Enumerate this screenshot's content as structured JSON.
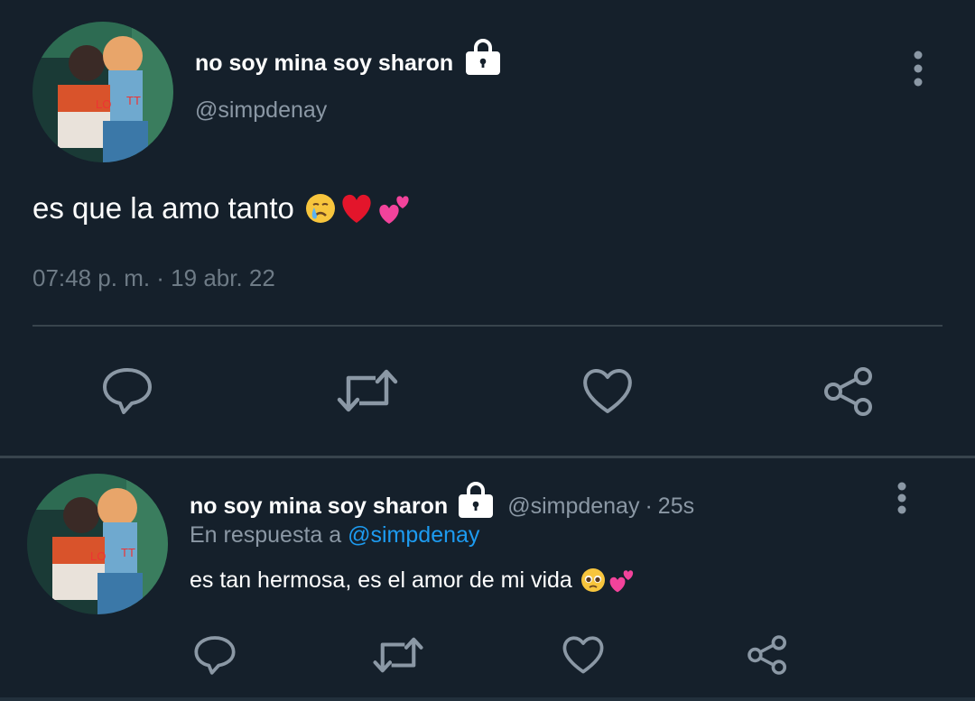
{
  "theme": {
    "background": "#15202b",
    "text_primary": "#ffffff",
    "text_secondary": "#8b98a5",
    "link": "#1d9bf0",
    "divider": "#38444d"
  },
  "main_tweet": {
    "display_name": "no soy mina soy sharon",
    "protected_icon": "lock-icon",
    "handle": "@simpdenay",
    "text": "es que la amo tanto",
    "emojis": [
      "crying-face-emoji",
      "red-heart-emoji",
      "two-hearts-emoji"
    ],
    "timestamp": "07:48 p. m. · 19 abr. 22",
    "actions": [
      "reply-icon",
      "retweet-icon",
      "like-icon",
      "share-icon"
    ]
  },
  "reply_tweet": {
    "display_name": "no soy mina soy sharon",
    "protected_icon": "lock-icon",
    "handle": "@simpdenay",
    "separator": "·",
    "time": "25s",
    "replying_to_prefix": "En respuesta a",
    "replying_to_handle": "@simpdenay",
    "text": "es tan hermosa, es el amor de mi vida",
    "emojis": [
      "pleading-face-emoji",
      "two-hearts-emoji"
    ],
    "actions": [
      "reply-icon",
      "retweet-icon",
      "like-icon",
      "share-icon"
    ]
  }
}
